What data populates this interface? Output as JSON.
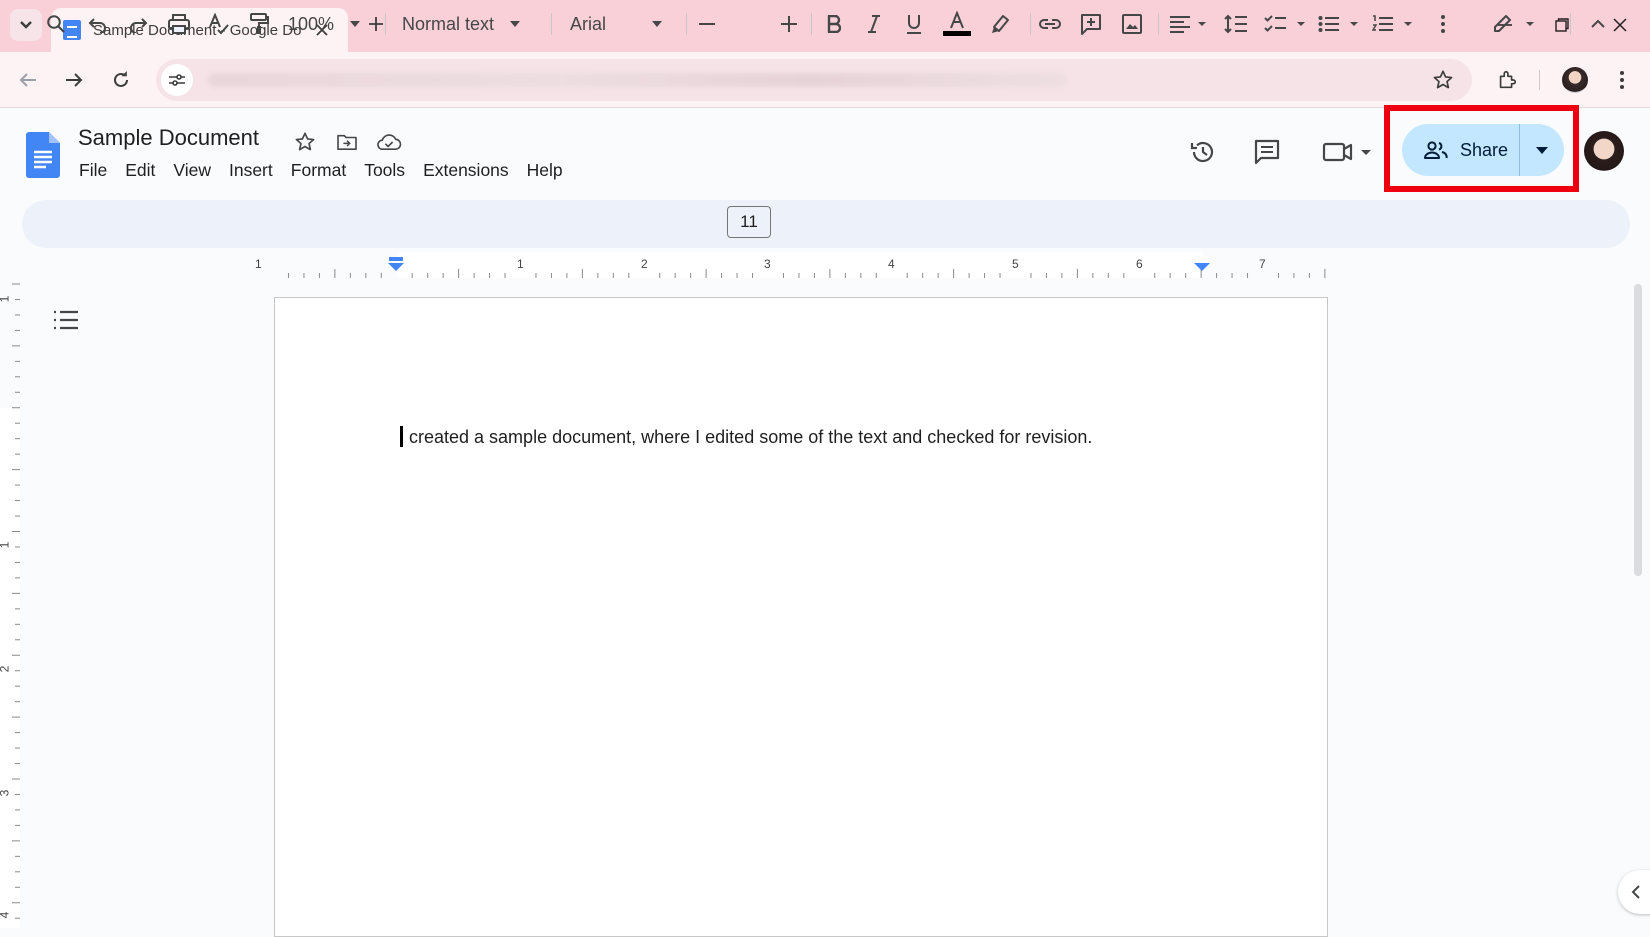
{
  "browser": {
    "tab_title": "Sample Document - Google Do",
    "url_obscured": true
  },
  "docs": {
    "title": "Sample Document",
    "menu": [
      "File",
      "Edit",
      "View",
      "Insert",
      "Format",
      "Tools",
      "Extensions",
      "Help"
    ],
    "share_label": "Share"
  },
  "format_toolbar": {
    "zoom": "100%",
    "style": "Normal text",
    "font": "Arial",
    "font_size": "11",
    "icons": [
      "search-icon",
      "undo-icon",
      "redo-icon",
      "print-icon",
      "spellcheck-icon",
      "paint-format-icon",
      "bold-icon",
      "italic-icon",
      "underline-icon",
      "text-color-icon",
      "highlight-icon",
      "link-icon",
      "add-comment-icon",
      "image-icon",
      "align-icon",
      "line-spacing-icon",
      "checklist-icon",
      "bullet-list-icon",
      "numbered-list-icon",
      "more-icon",
      "editing-mode-icon",
      "collapse-icon"
    ]
  },
  "ruler": {
    "horizontal_labels": [
      "1",
      "1",
      "2",
      "3",
      "4",
      "5",
      "6",
      "7"
    ],
    "vertical_labels": [
      "1",
      "1",
      "2",
      "3",
      "4"
    ]
  },
  "document": {
    "body_text": "created a sample document, where I edited some of the text and checked for revision."
  },
  "colors": {
    "tabstrip": "#f9cfd8",
    "share_button": "#c2e7ff",
    "highlight_outline": "#ee0010",
    "docs_blue": "#4285f4"
  }
}
